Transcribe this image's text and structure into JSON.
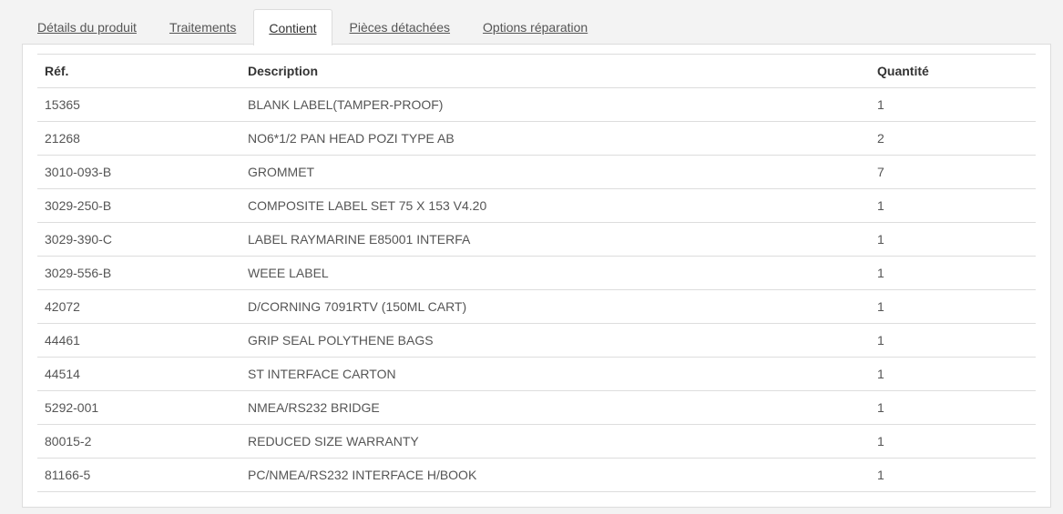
{
  "tabs": [
    {
      "label": "Détails du produit",
      "active": false
    },
    {
      "label": "Traitements",
      "active": false
    },
    {
      "label": "Contient",
      "active": true
    },
    {
      "label": "Pièces détachées",
      "active": false
    },
    {
      "label": "Options réparation",
      "active": false
    }
  ],
  "table": {
    "headers": {
      "ref": "Réf.",
      "description": "Description",
      "quantity": "Quantité"
    },
    "rows": [
      {
        "ref": "15365",
        "description": "BLANK LABEL(TAMPER-PROOF)",
        "quantity": "1"
      },
      {
        "ref": "21268",
        "description": "NO6*1/2 PAN HEAD POZI TYPE AB",
        "quantity": "2"
      },
      {
        "ref": "3010-093-B",
        "description": "GROMMET",
        "quantity": "7"
      },
      {
        "ref": "3029-250-B",
        "description": "COMPOSITE LABEL SET 75 X 153 V4.20",
        "quantity": "1"
      },
      {
        "ref": "3029-390-C",
        "description": "LABEL RAYMARINE E85001 INTERFA",
        "quantity": "1"
      },
      {
        "ref": "3029-556-B",
        "description": "WEEE LABEL",
        "quantity": "1"
      },
      {
        "ref": "42072",
        "description": "D/CORNING 7091RTV (150ML CART)",
        "quantity": "1"
      },
      {
        "ref": "44461",
        "description": "GRIP SEAL POLYTHENE BAGS",
        "quantity": "1"
      },
      {
        "ref": "44514",
        "description": "ST INTERFACE CARTON",
        "quantity": "1"
      },
      {
        "ref": "5292-001",
        "description": "NMEA/RS232 BRIDGE",
        "quantity": "1"
      },
      {
        "ref": "80015-2",
        "description": "REDUCED SIZE WARRANTY",
        "quantity": "1"
      },
      {
        "ref": "81166-5",
        "description": "PC/NMEA/RS232 INTERFACE H/BOOK",
        "quantity": "1"
      }
    ]
  }
}
